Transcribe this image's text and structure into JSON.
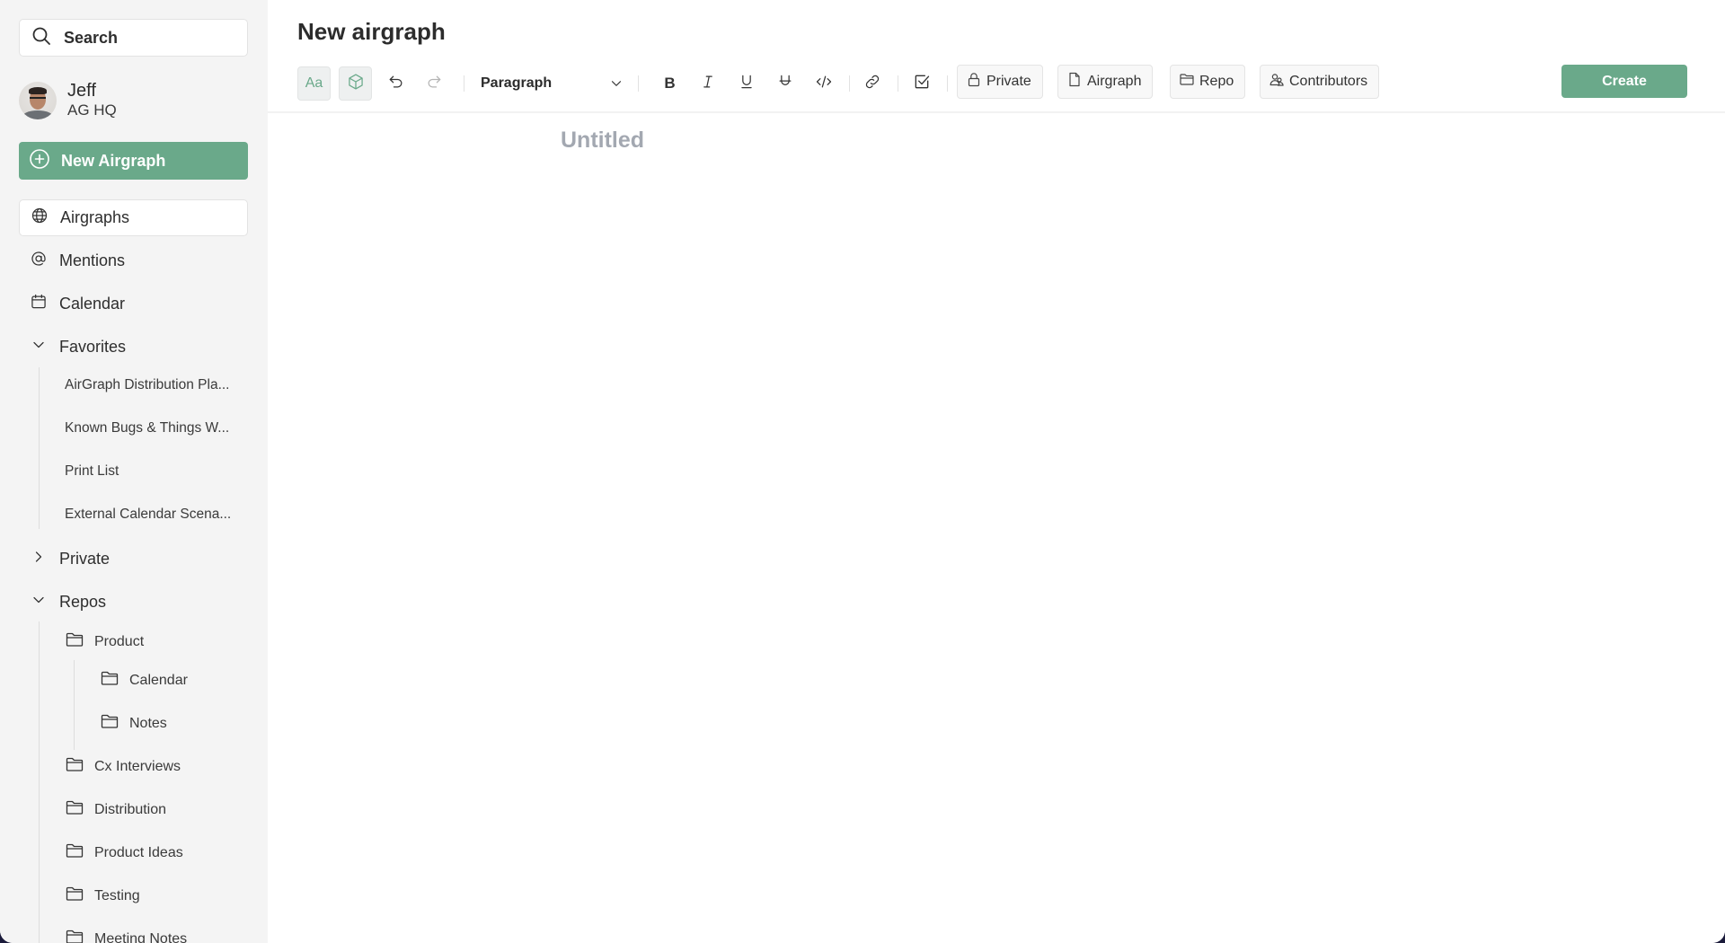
{
  "sidebar": {
    "search_label": "Search",
    "user": {
      "name": "Jeff",
      "org": "AG HQ"
    },
    "new_button_label": "New Airgraph",
    "nav": [
      {
        "label": "Airgraphs",
        "icon": "globe-icon",
        "active": true
      },
      {
        "label": "Mentions",
        "icon": "at-icon"
      },
      {
        "label": "Calendar",
        "icon": "calendar-icon"
      }
    ],
    "favorites": {
      "label": "Favorites",
      "expanded": true,
      "items": [
        "AirGraph Distribution Pla...",
        "Known Bugs & Things W...",
        "Print List",
        "External Calendar Scena..."
      ]
    },
    "private": {
      "label": "Private",
      "expanded": false
    },
    "repos": {
      "label": "Repos",
      "expanded": true,
      "items": [
        {
          "label": "Product",
          "children": [
            "Calendar",
            "Notes"
          ]
        },
        {
          "label": "Cx Interviews"
        },
        {
          "label": "Distribution"
        },
        {
          "label": "Product Ideas"
        },
        {
          "label": "Testing"
        },
        {
          "label": "Meeting Notes"
        }
      ]
    }
  },
  "header": {
    "title": "New airgraph",
    "toolbar": {
      "font_button": "Aa",
      "block_style": "Paragraph",
      "meta_buttons": [
        "Private",
        "Airgraph",
        "Repo",
        "Contributors"
      ],
      "create_label": "Create"
    }
  },
  "editor": {
    "title_placeholder": "Untitled"
  },
  "colors": {
    "accent": "#6aa98a",
    "sidebar_bg": "#f4f4f4",
    "placeholder": "#a3a8b1"
  }
}
